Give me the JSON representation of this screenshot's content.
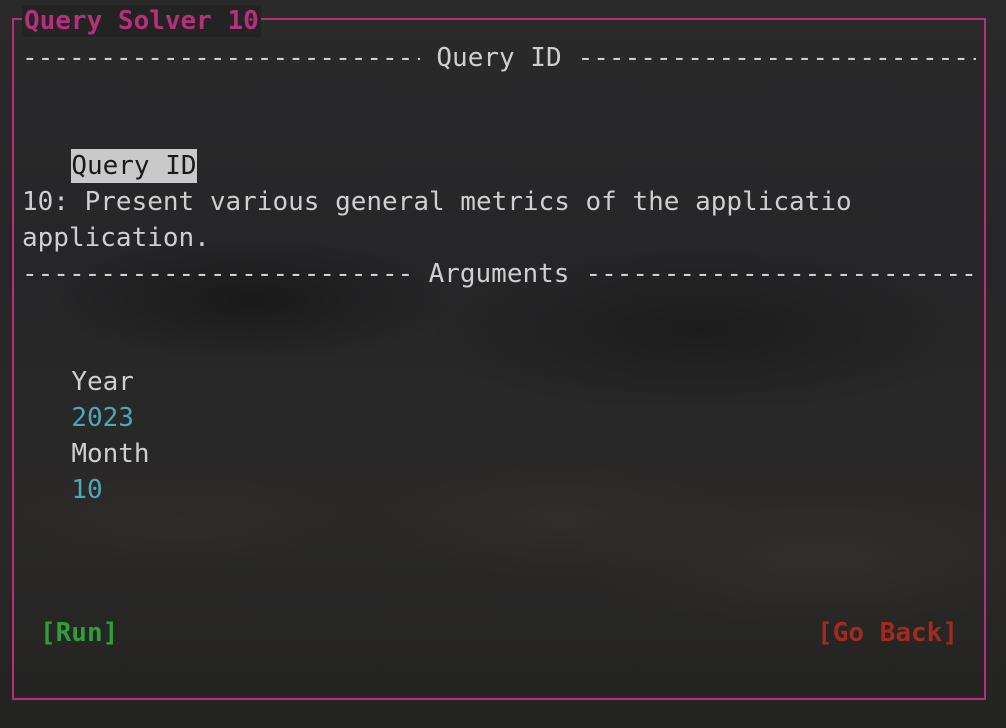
{
  "window": {
    "title": "Query Solver 10"
  },
  "sections": {
    "query_id_header": "Query ID",
    "arguments_header": "Arguments"
  },
  "query": {
    "field_label": "Query ID",
    "description_line1": "10: Present various general metrics of the applicatio",
    "description_line2": "application."
  },
  "arguments": {
    "year_label": "Year",
    "year_value": "2023",
    "month_label": "Month",
    "month_value": "10"
  },
  "buttons": {
    "run": "[Run]",
    "go_back": "[Go Back]"
  },
  "colors": {
    "frame": "#b5307a",
    "run": "#2f9d3a",
    "go_back": "#a32a1f",
    "value": "#4aa8b8",
    "highlight": "#c9c9c9"
  }
}
